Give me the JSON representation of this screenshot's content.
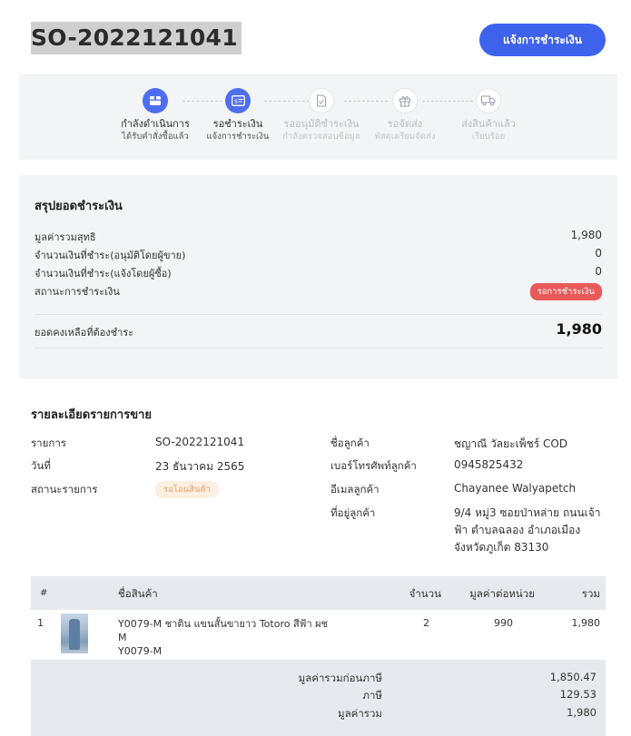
{
  "header": {
    "order_number": "SO-2022121041",
    "notify_payment_button": "แจ้งการชำระเงิน"
  },
  "steps": [
    {
      "label": "กำลังดำเนินการ",
      "sub": "ได้รับคำสั่งซื้อแล้ว",
      "icon": "box-icon",
      "state": "active"
    },
    {
      "label": "รอชำระเงิน",
      "sub": "แจ้งการชำระเงิน",
      "icon": "payment-card-icon",
      "state": "active"
    },
    {
      "label": "รออนุมัติชำระเงิน",
      "sub": "กำลังตรวจสอบข้อมูล",
      "icon": "document-check-icon",
      "state": "inactive"
    },
    {
      "label": "รอจัดส่ง",
      "sub": "พัสดุเตรียมจัดส่ง",
      "icon": "gift-box-icon",
      "state": "inactive"
    },
    {
      "label": "ส่งสินค้าแล้ว",
      "sub": "เรียบร้อย",
      "icon": "delivery-truck-icon",
      "state": "inactive"
    }
  ],
  "summary": {
    "title": "สรุปยอดชำระเงิน",
    "net_total_label": "มูลค่ารวมสุทธิ",
    "net_total": "1,980",
    "paid_seller_label": "จำนวนเงินที่ชำระ(อนุมัติโดยผู้ขาย)",
    "paid_seller": "0",
    "paid_buyer_label": "จำนวนเงินที่ชำระ(แจ้งโดยผู้ซื้อ)",
    "paid_buyer": "0",
    "payment_status_label": "สถานะการชำระเงิน",
    "payment_status": "รอการชำระเงิน",
    "balance_label": "ยอดคงเหลือที่ต้องชำระ",
    "balance": "1,980"
  },
  "details": {
    "title": "รายละเอียดรายการขาย",
    "item_label": "รายการ",
    "item_value": "SO-2022121041",
    "date_label": "วันที่",
    "date_value": "23 ธันวาคม 2565",
    "status_label": "สถานะรายการ",
    "status_value": "รอโอนสินค้า",
    "customer_name_label": "ชื่อลูกค้า",
    "customer_name": "ชญาณี วัลยะเพ็ชร์ COD",
    "phone_label": "เบอร์โทรศัพท์ลูกค้า",
    "phone": "0945825432",
    "email_label": "อีเมลลูกค้า",
    "email": "Chayanee Walyapetch",
    "address_label": "ที่อยู่ลูกค้า",
    "address": "9/4 หมู่3 ซอยป่าหล่าย ถนนเจ้าฟ้า ตำบลฉลอง อำเภอเมือง จังหวัดภูเก็ต 83130"
  },
  "table": {
    "headers": {
      "index": "#",
      "product": "ชื่อสินค้า",
      "qty": "จำนวน",
      "unit_price": "มูลค่าต่อหน่วย",
      "total": "รวม"
    },
    "rows": [
      {
        "index": "1",
        "name": "Y0079-M ชาติน แขนสั้นขายาว Totoro สีฟ้า ผช M",
        "sku": "Y0079-M",
        "qty": "2",
        "unit_price": "990",
        "total": "1,980"
      }
    ],
    "subtotal_label": "มูลค่ารวมก่อนภาษี",
    "subtotal": "1,850.47",
    "tax_label": "ภาษี",
    "tax": "129.53",
    "grand_total_label": "มูลค่ารวม",
    "grand_total": "1,980"
  }
}
